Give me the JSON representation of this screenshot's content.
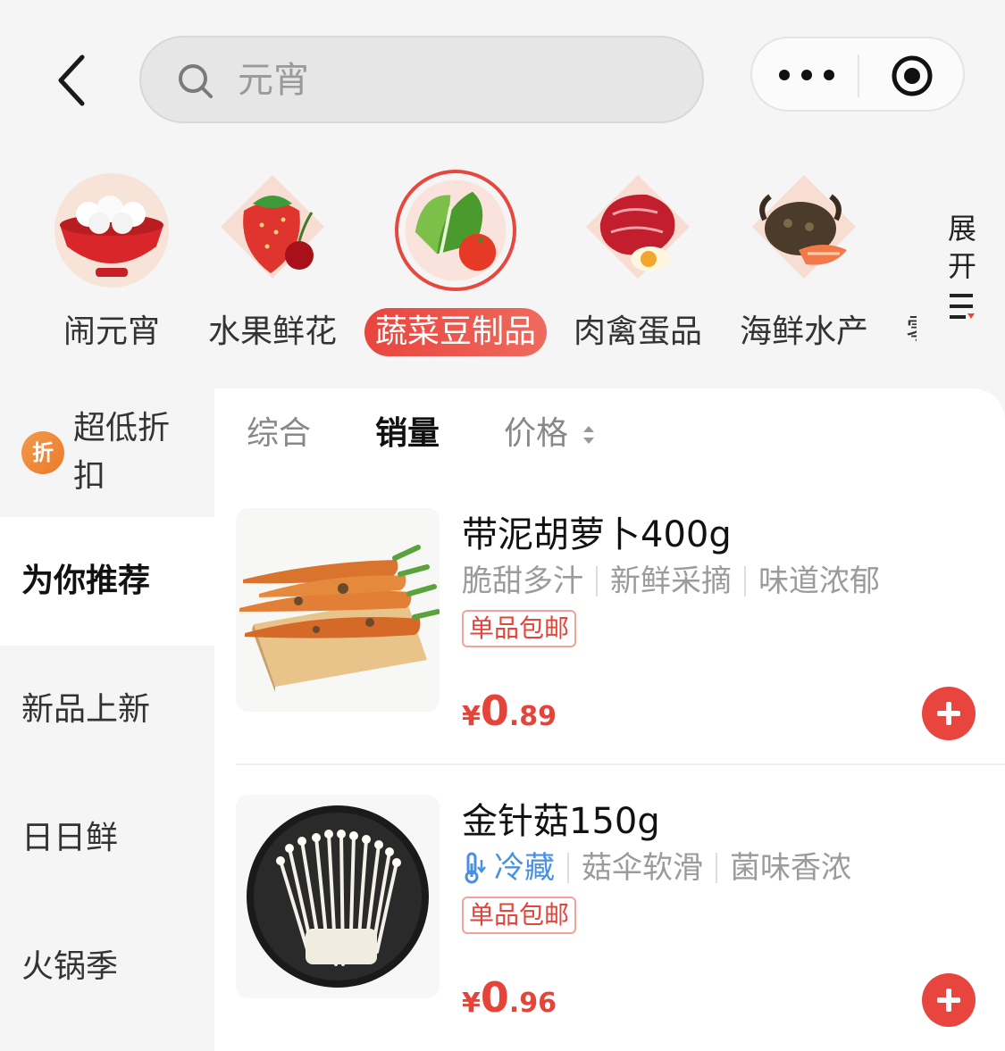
{
  "search": {
    "placeholder": "元宵"
  },
  "categories": [
    {
      "label": "闹元宵",
      "icon": "tangyuan-bowl-icon",
      "active": false
    },
    {
      "label": "水果鲜花",
      "icon": "strawberry-icon",
      "active": false
    },
    {
      "label": "蔬菜豆制品",
      "icon": "vegetables-icon",
      "active": true
    },
    {
      "label": "肉禽蛋品",
      "icon": "meat-egg-icon",
      "active": false
    },
    {
      "label": "海鲜水产",
      "icon": "seafood-icon",
      "active": false
    },
    {
      "label": "零",
      "icon": "",
      "active": false
    }
  ],
  "expand": {
    "line1": "展",
    "line2": "开"
  },
  "sidebar": {
    "discount": {
      "badge": "折",
      "label": "超低折扣"
    },
    "items": [
      {
        "label": "为你推荐",
        "active": true
      },
      {
        "label": "新品上新",
        "active": false
      },
      {
        "label": "日日鲜",
        "active": false
      },
      {
        "label": "火锅季",
        "active": false
      }
    ]
  },
  "sort": {
    "items": [
      "综合",
      "销量",
      "价格"
    ],
    "active": "销量"
  },
  "products": [
    {
      "name": "带泥胡萝卜400g",
      "tags": [
        "脆甜多汁",
        "新鲜采摘",
        "味道浓郁"
      ],
      "cold_tag": "",
      "badge": "单品包邮",
      "currency": "¥",
      "price_int": "0",
      "price_dec": ".89",
      "image": "carrots-icon"
    },
    {
      "name": "金针菇150g",
      "tags": [
        "菇伞软滑",
        "菌味香浓"
      ],
      "cold_tag": "冷藏",
      "badge": "单品包邮",
      "currency": "¥",
      "price_int": "0",
      "price_dec": ".96",
      "image": "enoki-mushroom-icon"
    }
  ],
  "colors": {
    "accent": "#e8453e",
    "price": "#e4443a",
    "cold": "#4a90e2"
  }
}
